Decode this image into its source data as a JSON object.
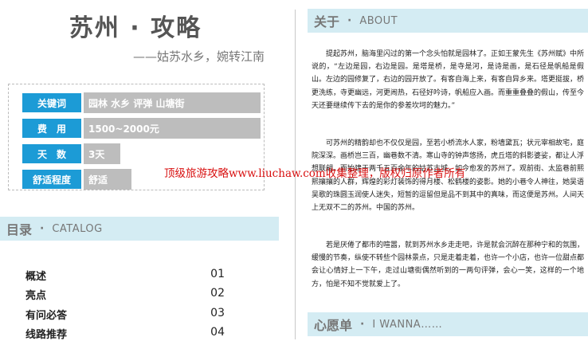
{
  "header": {
    "title": "苏州 · 攻略",
    "subtitle": "——姑苏水乡，婉转江南"
  },
  "info": [
    {
      "label": "关键词",
      "value": "园林 水乡 评弹 山塘街"
    },
    {
      "label": "费　用",
      "value": "1500~2000元"
    },
    {
      "label": "天　数",
      "value": "3天"
    },
    {
      "label": "舒适程度",
      "value": "舒适"
    }
  ],
  "catalog": {
    "heading_zh": "目录",
    "heading_en": "CATALOG",
    "items": [
      {
        "label": "概述",
        "num": "01"
      },
      {
        "label": "亮点",
        "num": "02"
      },
      {
        "label": "有问必答",
        "num": "03"
      },
      {
        "label": "线路推荐",
        "num": "04"
      }
    ]
  },
  "about": {
    "heading_zh": "关于",
    "heading_en": "ABOUT",
    "paragraphs": [
      "提起苏州，脑海里闪过的第一个念头怕就是园林了。正如王蒙先生《苏州赋》中所说的，“左边是园，右边是园。是塔是桥，是寺是河，是诗是画，是石径是帆船是假山。左边的园修复了，右边的园开放了。有客自海上来，有客自异乡来。塔更挺拔，桥更洗练，寺更幽远，河更闹热，石径好吟诗，帆船应入画。而重重叠叠的假山，传至今天还要继续传下去的是你的参差坎坷的魅力。”",
      "可苏州的精韵却也不仅仅是园，至若小桥流水人家，粉墙黛瓦；状元宰相故宅，庭院深深。画桥岂三百，幽巷数不清。寒山寺的钟声悠扬，虎丘塔的斜影婆娑，都让人浮想联翩。而始建于两千五百余年的姑苏古城，如今愈发的苏州了。观前街、太监巷前熙熙攘攘的人群，辉煌的彩灯装饰的得月楼、松鹤楼的姿影。她的小巷令人神往，她吴语吴歌的珠圆玉润使人迷失，短暂的逗留但是品不到其中的真味，而这便是苏州。人间天上无双不二的苏州。中国的苏州。",
      "若是厌倦了都市的喧嚣，就到苏州水乡走走吧，许是就会沉醉在那种宁和的氛围，缓慢的节奏，纵使不转些个园林景点，只是走着走着，也许一个小店，也许一位甜点都会让心情好上一下午，走过山塘街偶然听到的一两句评弹，会心一笑，这样的一个地方，怕是不知不觉就爱上了。"
    ]
  },
  "wish": {
    "heading_zh": "心愿单",
    "heading_en": "I WANNA……"
  },
  "watermark": "顶级旅游攻略www.liuchaw.com收集整理，版权归原作者所有"
}
